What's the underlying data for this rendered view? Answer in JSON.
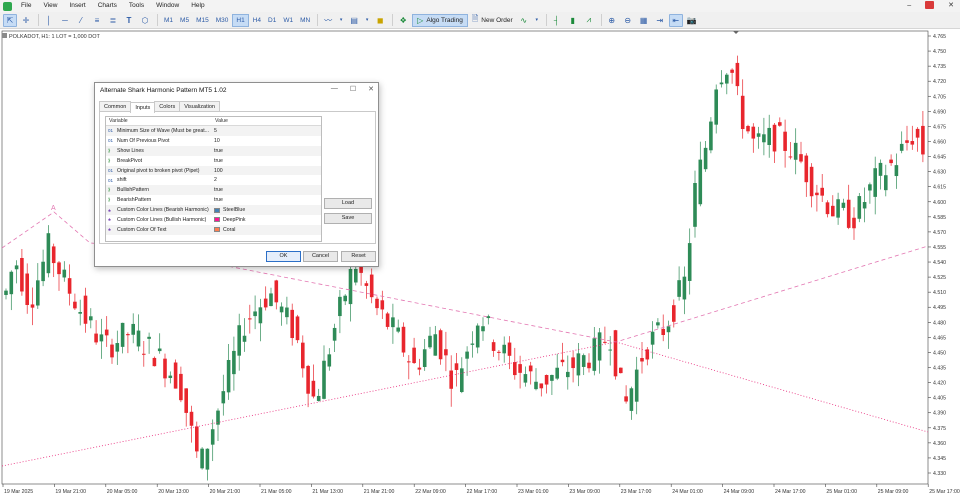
{
  "menubar": {
    "items": [
      "File",
      "View",
      "Insert",
      "Charts",
      "Tools",
      "Window",
      "Help"
    ]
  },
  "toolbar": {
    "timeframes": [
      "M1",
      "M5",
      "M15",
      "M30",
      "H1",
      "H4",
      "D1",
      "W1",
      "MN"
    ],
    "active_timeframe": "H1",
    "algo_trading": "Algo Trading",
    "new_order": "New Order"
  },
  "chart": {
    "symbol_label": "POLKADOT, H1:  1 LOT = 1,000 DOT",
    "pattern_point_label": "A",
    "price_labels": [
      "4.765",
      "4.750",
      "4.735",
      "4.720",
      "4.705",
      "4.690",
      "4.675",
      "4.660",
      "4.645",
      "4.630",
      "4.615",
      "4.600",
      "4.585",
      "4.570",
      "4.555",
      "4.540",
      "4.525",
      "4.510",
      "4.495",
      "4.480",
      "4.465",
      "4.450",
      "4.435",
      "4.420",
      "4.405",
      "4.390",
      "4.375",
      "4.360",
      "4.345",
      "4.330"
    ],
    "time_labels": [
      "19 Mar 2025",
      "19 Mar 21:00",
      "20 Mar 05:00",
      "20 Mar 13:00",
      "20 Mar 21:00",
      "21 Mar 05:00",
      "21 Mar 13:00",
      "21 Mar 21:00",
      "22 Mar 09:00",
      "22 Mar 17:00",
      "23 Mar 01:00",
      "23 Mar 09:00",
      "23 Mar 17:00",
      "24 Mar 01:00",
      "24 Mar 09:00",
      "24 Mar 17:00",
      "25 Mar 01:00",
      "25 Mar 09:00",
      "25 Mar 17:00"
    ],
    "colors": {
      "bull": "#2e8b57",
      "bear": "#e8262d",
      "dashed_line": "#e377b2",
      "dotted_line": "#e8297a"
    }
  },
  "dialog": {
    "title": "Alternate Shark Harmonic Pattern MT5 1.02",
    "tabs": [
      "Common",
      "Inputs",
      "Colors",
      "Visualization"
    ],
    "active_tab": "Inputs",
    "table_headers": {
      "variable": "Variable",
      "value": "Value"
    },
    "rows": [
      {
        "type": "01",
        "kind": "int",
        "name": "Minimum Size of Wave (Must be great...",
        "value": "5"
      },
      {
        "type": "01",
        "kind": "int",
        "name": "Num Of Previous Pivot",
        "value": "10"
      },
      {
        "type": "bool",
        "kind": "bool",
        "name": "Show Lines",
        "value": "true"
      },
      {
        "type": "bool",
        "kind": "bool",
        "name": "BreakPivot",
        "value": "true"
      },
      {
        "type": "01",
        "kind": "int",
        "name": "Original pivot to broken pivot (Pipet)",
        "value": "100"
      },
      {
        "type": "01",
        "kind": "int",
        "name": "shift",
        "value": "2"
      },
      {
        "type": "bool",
        "kind": "bool",
        "name": "BullishPattern",
        "value": "true"
      },
      {
        "type": "bool",
        "kind": "bool",
        "name": "BearishPattern",
        "value": "true"
      },
      {
        "type": "color",
        "kind": "color",
        "name": "Custom Color Lines (Bearish Harmonic)",
        "value": "SteelBlue",
        "swatch": "#4682b4"
      },
      {
        "type": "color",
        "kind": "color",
        "name": "Custom Color Lines (Bullish Harmonic)",
        "value": "DeepPink",
        "swatch": "#ff1493"
      },
      {
        "type": "color",
        "kind": "color",
        "name": "Custom Color Of Text",
        "value": "Coral",
        "swatch": "#ff7f50"
      }
    ],
    "load_label": "Load",
    "save_label": "Save",
    "ok_label": "OK",
    "cancel_label": "Cancel",
    "reset_label": "Reset"
  }
}
